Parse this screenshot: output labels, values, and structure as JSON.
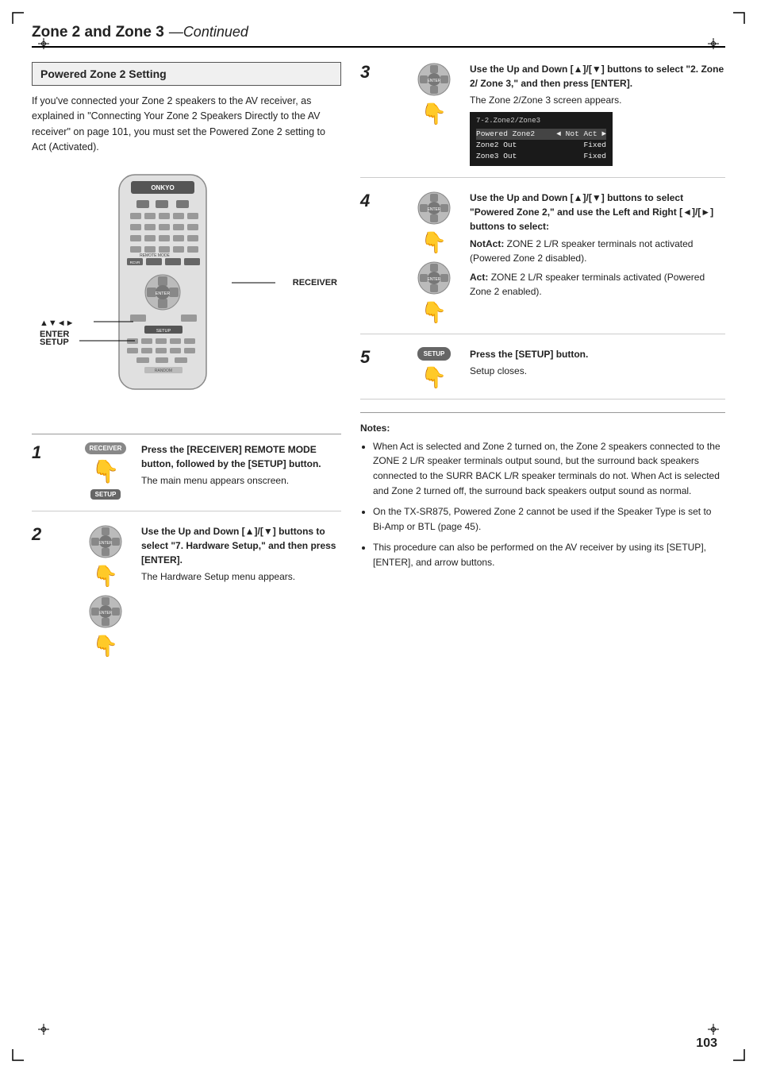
{
  "page": {
    "title_main": "Zone 2 and Zone 3",
    "title_sub": "—Continued",
    "page_number": "103"
  },
  "section_title": "Powered Zone 2 Setting",
  "left_intro": "If you've connected your Zone 2 speakers to the AV receiver, as explained in \"Connecting Your Zone 2 Speakers Directly to the AV receiver\" on page 101, you must set the Powered Zone 2 setting to Act (Activated).",
  "remote_labels": {
    "enter": "▲▼◄►\nENTER",
    "setup": "SETUP",
    "receiver": "RECEIVER"
  },
  "steps_left": [
    {
      "num": "1",
      "title": "Press the [RECEIVER] REMOTE MODE button, followed by the [SETUP] button.",
      "desc": "The main menu appears onscreen."
    },
    {
      "num": "2",
      "title": "Use the Up and Down [▲]/[▼] buttons to select \"7. Hardware Setup,\" and then press [ENTER].",
      "desc": "The Hardware Setup menu appears."
    }
  ],
  "steps_right": [
    {
      "num": "3",
      "title": "Use the Up and Down [▲]/[▼] buttons to select \"2. Zone 2/ Zone 3,\" and then press [ENTER].",
      "desc": "The Zone 2/Zone 3 screen appears.",
      "screen": {
        "header": "7-2.Zone2/Zone3",
        "rows": [
          {
            "label": "Powered Zone2",
            "value": "◄ Not Act ►",
            "highlight": true
          },
          {
            "label": "Zone2 Out",
            "value": "Fixed"
          },
          {
            "label": "Zone3 Out",
            "value": "Fixed"
          }
        ]
      }
    },
    {
      "num": "4",
      "title": "Use the Up and Down [▲]/[▼] buttons to select \"Powered Zone 2,\" and use the Left and Right [◄]/[►] buttons to select:",
      "items": [
        {
          "label": "NotAct:",
          "desc": "ZONE 2 L/R speaker terminals not activated (Powered Zone 2 disabled)."
        },
        {
          "label": "Act:",
          "desc": "ZONE 2 L/R speaker terminals activated (Powered Zone 2 enabled)."
        }
      ]
    },
    {
      "num": "5",
      "title": "Press the [SETUP] button.",
      "desc": "Setup closes."
    }
  ],
  "notes": {
    "title": "Notes:",
    "items": [
      "When Act is selected and Zone 2 turned on, the Zone 2 speakers connected to the ZONE 2 L/R speaker terminals output sound, but the surround back speakers connected to the SURR BACK L/R speaker terminals do not. When Act is selected and Zone 2 turned off, the surround back speakers output sound as normal.",
      "On the TX-SR875, Powered Zone 2 cannot be used if the Speaker Type is set to Bi-Amp or BTL (page 45).",
      "This procedure can also be performed on the AV receiver by using its [SETUP], [ENTER], and arrow buttons."
    ]
  }
}
